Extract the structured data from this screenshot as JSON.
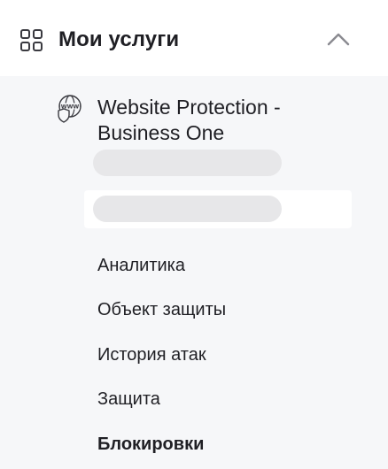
{
  "header": {
    "title": "Мои услуги",
    "icon": "grid-icon",
    "toggle_icon": "chevron-up-icon"
  },
  "service": {
    "icon": "www-shield-icon",
    "title": "Website Protection - Business One"
  },
  "menu": {
    "items": [
      {
        "label": "Аналитика"
      },
      {
        "label": "Объект защиты"
      },
      {
        "label": "История атак"
      },
      {
        "label": "Защита"
      },
      {
        "label": "Блокировки",
        "active": true
      }
    ]
  },
  "colors": {
    "background": "#f6f7f9",
    "header_bg": "#ffffff",
    "text": "#1f1f24",
    "skeleton": "#e7e7e9",
    "icon_stroke": "#3a3a40",
    "chevron": "#8a8a90"
  }
}
